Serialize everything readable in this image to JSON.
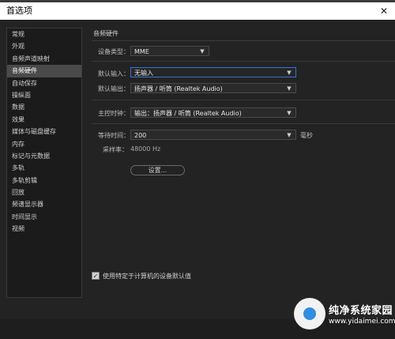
{
  "window": {
    "title": "首选项"
  },
  "sidebar": {
    "items": [
      {
        "label": "常规"
      },
      {
        "label": "外观"
      },
      {
        "label": "音频声道映射"
      },
      {
        "label": "音频硬件"
      },
      {
        "label": "自动保存"
      },
      {
        "label": "操纵面"
      },
      {
        "label": "数据"
      },
      {
        "label": "效果"
      },
      {
        "label": "媒体与磁盘缓存"
      },
      {
        "label": "内存"
      },
      {
        "label": "标记与元数据"
      },
      {
        "label": "多轨"
      },
      {
        "label": "多轨剪辑"
      },
      {
        "label": "回放"
      },
      {
        "label": "频谱显示器"
      },
      {
        "label": "时间显示"
      },
      {
        "label": "视频"
      }
    ],
    "selected": "音频硬件"
  },
  "panel": {
    "section_title": "音频硬件",
    "device_type": {
      "label": "设备类型：",
      "value": "MME"
    },
    "default_input": {
      "label": "默认输入：",
      "value": "无输入"
    },
    "default_output": {
      "label": "默认输出：",
      "value": "扬声器 / 听筒 (Realtek Audio)"
    },
    "master_clock": {
      "label": "主控时钟：",
      "value": "输出：扬声器 / 听筒 (Realtek Audio)"
    },
    "latency": {
      "label": "等待时间：",
      "value": "200",
      "unit": "毫秒"
    },
    "sample_rate": {
      "label": "采样率：",
      "value": "48000 Hz"
    },
    "settings_button": "设置...",
    "use_computer_defaults": {
      "label": "使用特定于计算机的设备默认值",
      "checked": true
    }
  },
  "colors": {
    "focus": "#2f74d9",
    "background": "#232323"
  },
  "icons": {
    "close": "close-icon",
    "chevron": "chevron-down-icon",
    "check": "checkmark-icon"
  },
  "watermark": {
    "brand": "纯净系统家园",
    "url": "www.yidaimei.com"
  }
}
